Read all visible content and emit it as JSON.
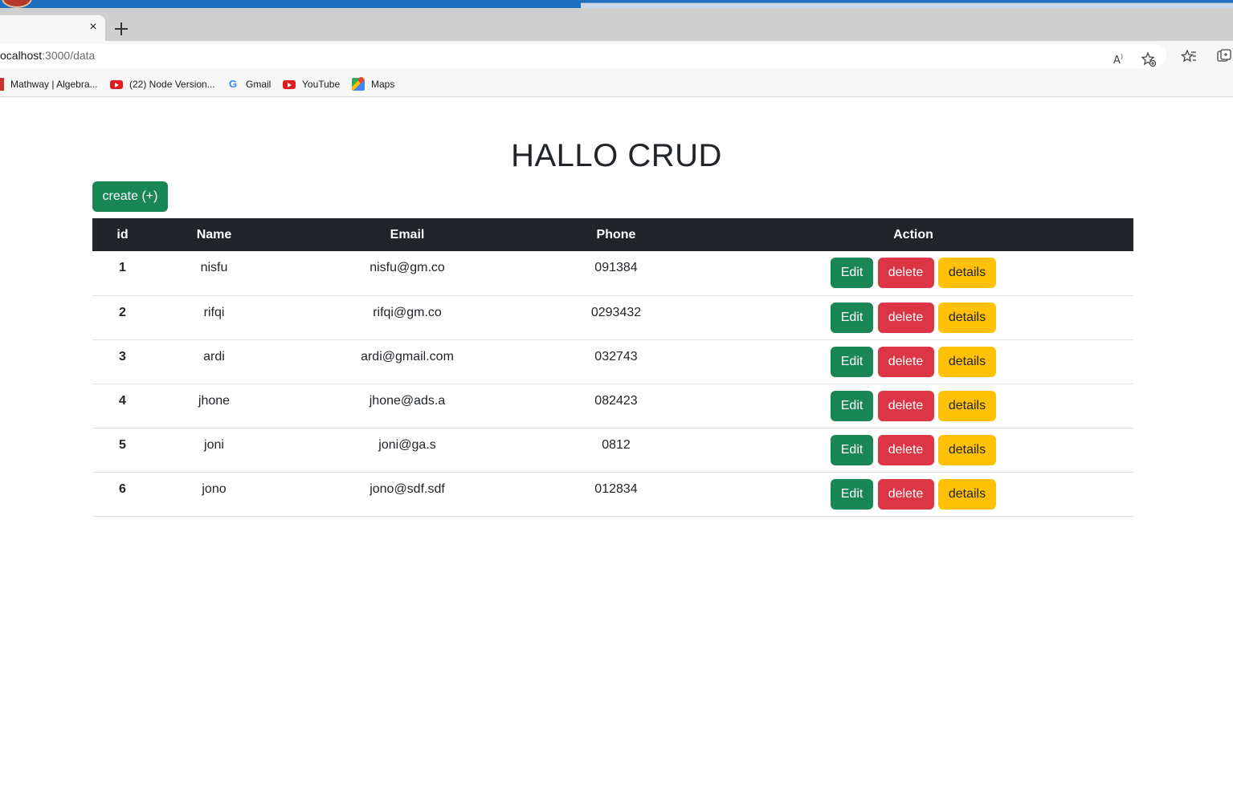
{
  "browser": {
    "tab": {
      "close_glyph": "×"
    },
    "new_tab_glyph": "+",
    "url": {
      "host": "ocalhost",
      "path": ":3000/data"
    },
    "bookmarks": [
      {
        "label": "Mathway | Algebra...",
        "icon": "mathway-icon"
      },
      {
        "label": "(22) Node Version...",
        "icon": "youtube-icon"
      },
      {
        "label": "Gmail",
        "icon": "google-icon"
      },
      {
        "label": "YouTube",
        "icon": "youtube-icon"
      },
      {
        "label": "Maps",
        "icon": "maps-icon"
      }
    ]
  },
  "page": {
    "title": "HALLO CRUD",
    "create_label": "create (+)"
  },
  "table": {
    "headers": {
      "id": "id",
      "name": "Name",
      "email": "Email",
      "phone": "Phone",
      "action": "Action"
    },
    "rows": [
      {
        "id": "1",
        "name": "nisfu",
        "email": "nisfu@gm.co",
        "phone": "091384"
      },
      {
        "id": "2",
        "name": "rifqi",
        "email": "rifqi@gm.co",
        "phone": "0293432"
      },
      {
        "id": "3",
        "name": "ardi",
        "email": "ardi@gmail.com",
        "phone": "032743"
      },
      {
        "id": "4",
        "name": "jhone",
        "email": "jhone@ads.a",
        "phone": "082423"
      },
      {
        "id": "5",
        "name": "joni",
        "email": "joni@ga.s",
        "phone": "0812"
      },
      {
        "id": "6",
        "name": "jono",
        "email": "jono@sdf.sdf",
        "phone": "012834"
      }
    ],
    "actions": {
      "edit": "Edit",
      "delete": "delete",
      "details": "details"
    }
  },
  "colors": {
    "success": "#198754",
    "danger": "#dc3545",
    "warning": "#ffc107",
    "table_header": "#212529"
  }
}
